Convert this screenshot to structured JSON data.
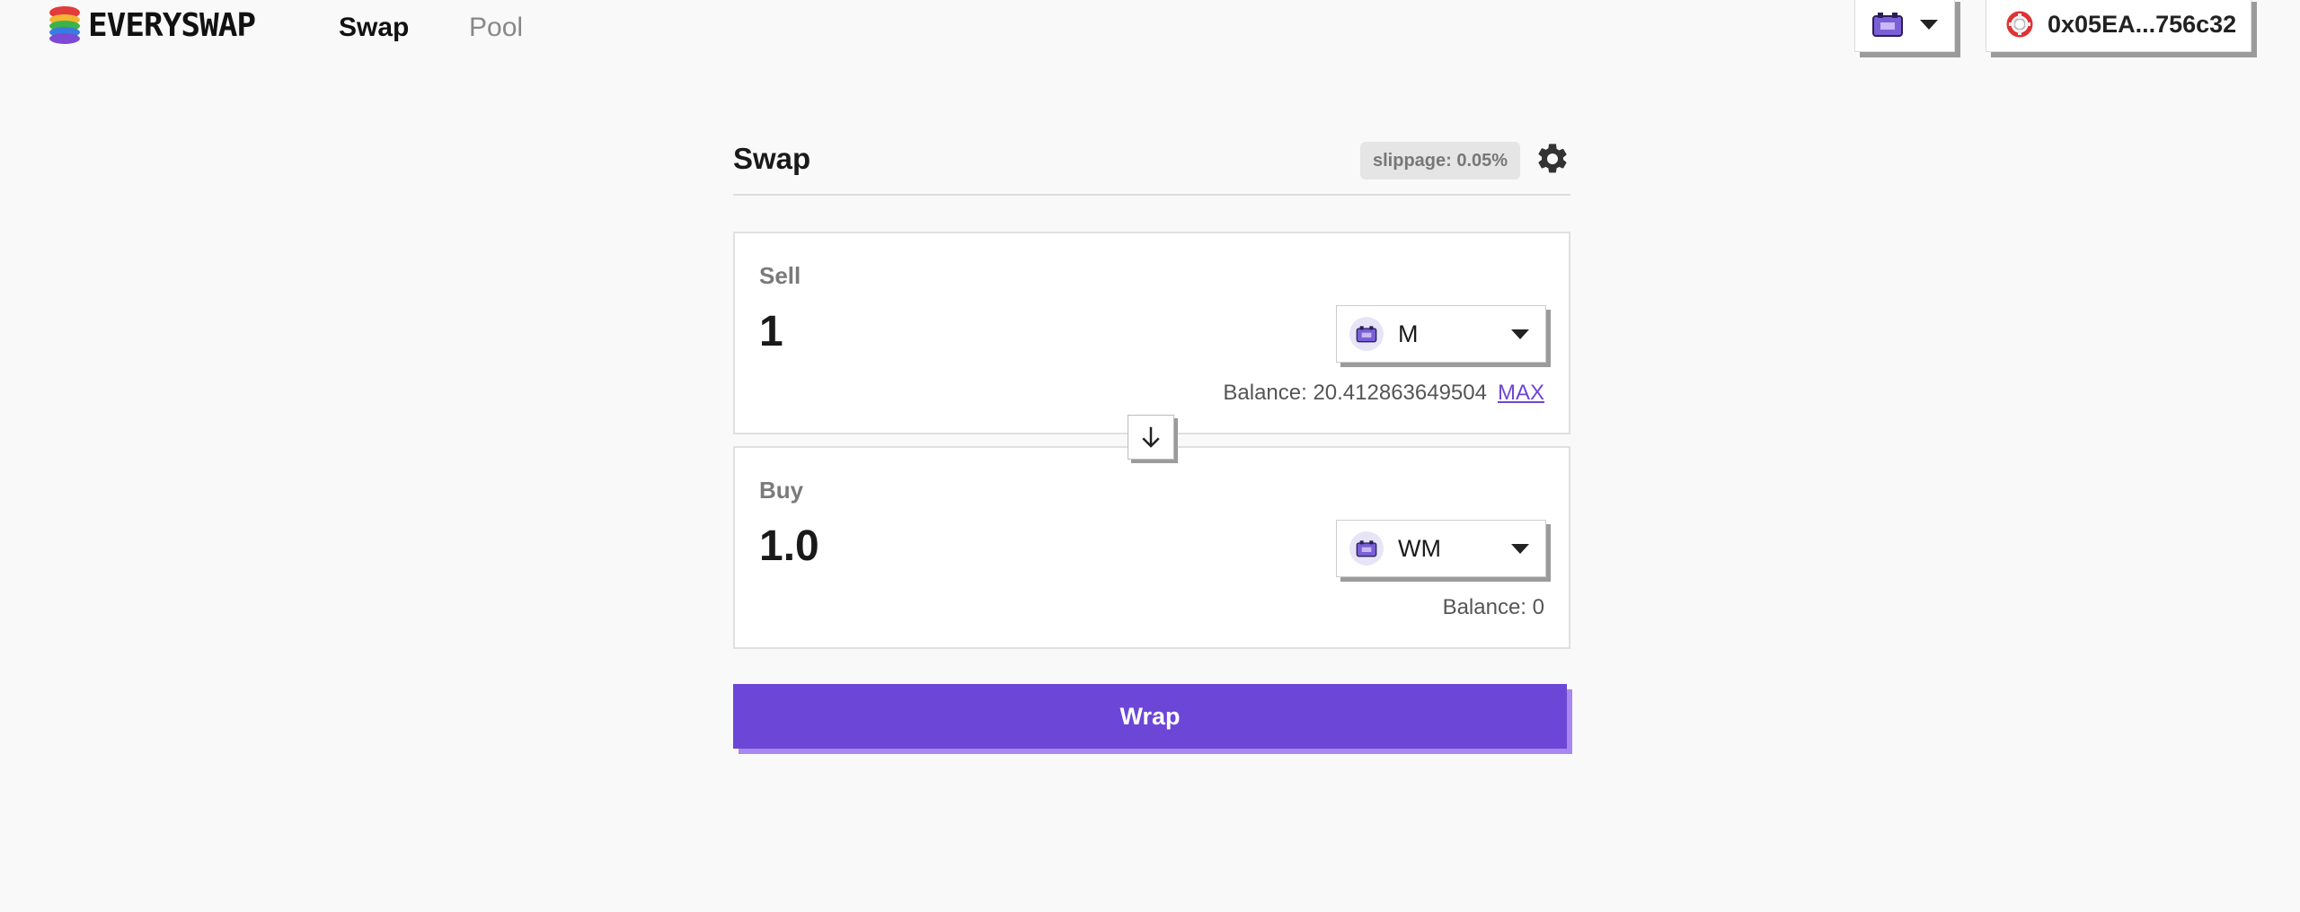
{
  "header": {
    "logo_text": "EVERYSWAP",
    "nav": [
      {
        "label": "Swap"
      },
      {
        "label": "Pool"
      }
    ],
    "chain_icon": "chain-token-icon",
    "account": {
      "icon": "lifebuoy-icon",
      "label": "0x05EA...756c32"
    }
  },
  "swap": {
    "title": "Swap",
    "slippage": "slippage: 0.05%",
    "settings_icon": "gear-icon",
    "sell": {
      "label": "Sell",
      "amount": "1",
      "token": "M",
      "balance": "Balance: 20.412863649504",
      "max_label": "MAX"
    },
    "buy": {
      "label": "Buy",
      "amount": "1.0",
      "token": "WM",
      "balance": "Balance: 0"
    },
    "switch_icon": "arrow-down-icon",
    "action_label": "Wrap"
  },
  "colors": {
    "accent": "#6c46d6",
    "accent_shadow": "#a888ee",
    "background": "#f9f9f9"
  }
}
